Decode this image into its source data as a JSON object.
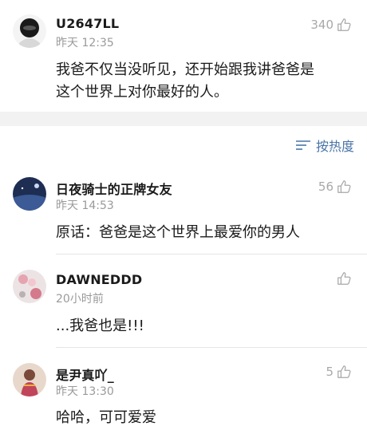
{
  "top_comment": {
    "username": "U2647LL",
    "time": "昨天 12:35",
    "likes": "340",
    "text_line1": "我爸不仅当没听见，还开始跟我讲爸爸是",
    "text_line2": "这个世界上对你最好的人。"
  },
  "sort": {
    "label": "按热度",
    "icon": "sort-lines-icon"
  },
  "replies": [
    {
      "username": "日夜骑士的正牌女友",
      "time": "昨天 14:53",
      "likes": "56",
      "text": "原话：爸爸是这个世界上最爱你的男人"
    },
    {
      "username": "DAWNEDDD",
      "time": "20小时前",
      "likes": "",
      "text": "...我爸也是!!!"
    },
    {
      "username": "是尹真吖_",
      "time": "昨天 13:30",
      "likes": "5",
      "text": "哈哈，可可爱爱"
    }
  ],
  "colors": {
    "accent": "#4a74a8",
    "muted": "#9a9a9a",
    "separator": "#f2f2f2"
  }
}
